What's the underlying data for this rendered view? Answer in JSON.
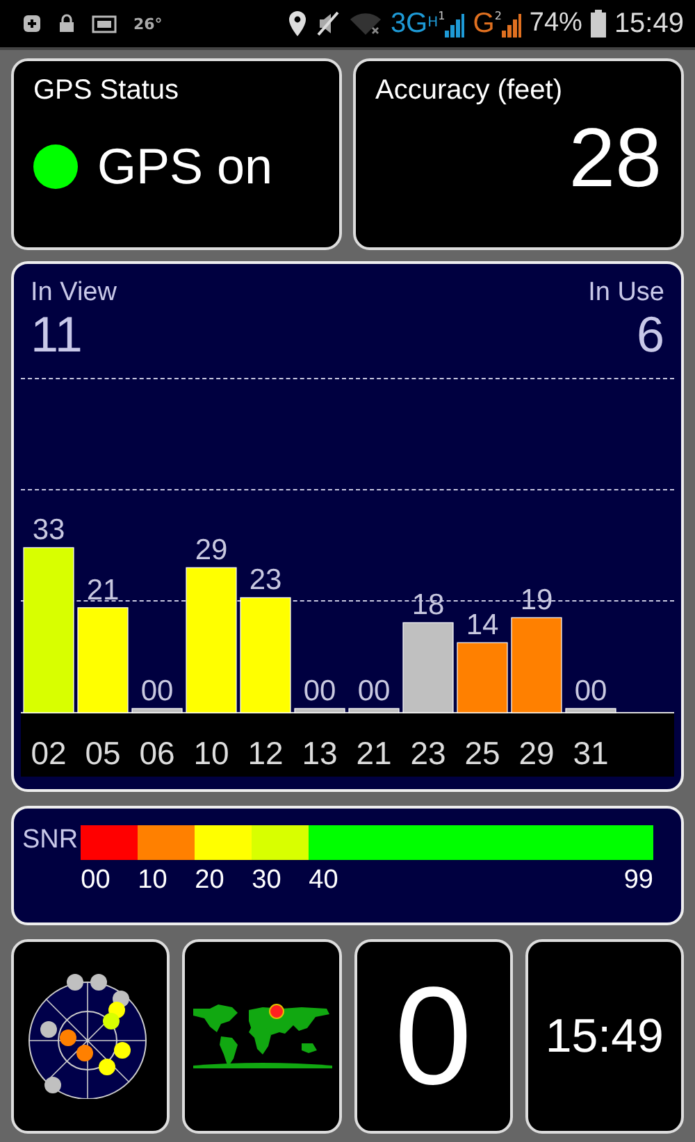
{
  "status_bar": {
    "temperature": "26°",
    "networks": [
      {
        "label": "3G",
        "sub": "H",
        "sim": "1",
        "color": "#1e9ad6"
      },
      {
        "label": "G",
        "sim": "2",
        "color": "#e07020"
      }
    ],
    "battery": "74%",
    "time": "15:49"
  },
  "gps_status": {
    "title": "GPS Status",
    "on": true,
    "text": "GPS on"
  },
  "accuracy": {
    "title": "Accuracy (feet)",
    "value": "28"
  },
  "satellites": {
    "in_view_label": "In View",
    "in_view": "11",
    "in_use_label": "In Use",
    "in_use": "6",
    "used": [
      true,
      true,
      false,
      true,
      true,
      false,
      false,
      false,
      true,
      true,
      false
    ],
    "chart_data": {
      "type": "bar",
      "categories": [
        "02",
        "05",
        "06",
        "10",
        "12",
        "13",
        "21",
        "23",
        "25",
        "29",
        "31"
      ],
      "values": [
        33,
        21,
        0,
        29,
        23,
        0,
        0,
        18,
        14,
        19,
        0
      ],
      "data_labels": true,
      "value_labels": [
        "33",
        "21",
        "00",
        "29",
        "23",
        "00",
        "00",
        "18",
        "14",
        "19",
        "00"
      ]
    }
  },
  "snr_scale": {
    "label": "SNR",
    "segments": [
      {
        "color": "#ff0000"
      },
      {
        "color": "#ff8000"
      },
      {
        "color": "#ffff00"
      },
      {
        "color": "#d8ff00"
      },
      {
        "color": "#00ff00"
      }
    ],
    "ticks": [
      "00",
      "10",
      "20",
      "30",
      "40",
      "99"
    ]
  },
  "tiles": [
    {
      "kind": "skyplot"
    },
    {
      "kind": "map"
    },
    {
      "kind": "number",
      "value": "0"
    },
    {
      "kind": "clock",
      "value": "15:49"
    }
  ]
}
